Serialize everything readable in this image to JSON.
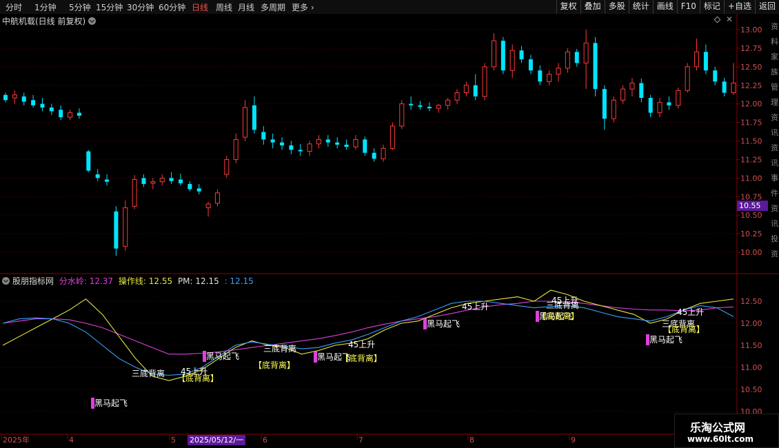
{
  "toolbar": {
    "timeframes": [
      "分时",
      "1分钟",
      "5分钟",
      "15分钟",
      "30分钟",
      "60分钟",
      "日线",
      "周线",
      "月线",
      "多周期",
      "更多"
    ],
    "active": "日线",
    "buttons": [
      "复权",
      "叠加",
      "多股",
      "统计",
      "画线",
      "F10",
      "标记",
      "+自选",
      "返回"
    ]
  },
  "main_chart": {
    "title": "中航机载(日线 前复权)",
    "price_axis_labels": [
      "13.00",
      "12.75",
      "12.50",
      "12.25",
      "12.00",
      "11.75",
      "11.50",
      "11.25",
      "11.00",
      "10.75",
      "10.50",
      "10.25",
      "10.00"
    ],
    "current_price_tag": "10.55"
  },
  "indicator": {
    "name": "股朋指标网",
    "items": [
      {
        "label": "分水岭: 12.37",
        "color": "#e040e0"
      },
      {
        "label": "操作线: 12.55",
        "color": "#e8e840"
      },
      {
        "label": "PM: 12.15",
        "color": "#e0e0e0"
      },
      {
        "label": ": 12.15",
        "color": "#3aa0ff"
      }
    ],
    "axis_labels": [
      "12.50",
      "12.00",
      "11.50",
      "11.00",
      "10.50",
      "10.00"
    ],
    "annotations": [
      "黑马起飞",
      "三底背离",
      "【底背离】",
      "45上升"
    ]
  },
  "date_axis": {
    "labels": [
      "2025年",
      "4",
      "5",
      "6",
      "7",
      "8",
      "9"
    ],
    "highlighted": "2025/05/12/一"
  },
  "side_text": "资料家族管理资讯资讯事件资讯投资",
  "watermark": {
    "line1": "乐淘公式网",
    "line2": "www.60lt.com"
  },
  "colors": {
    "up": "#ff3b3b",
    "down": "#00e5ff",
    "grid": "#5a0000",
    "axis": "#8b0000"
  },
  "chart_data": [
    {
      "type": "candlestick",
      "title": "中航机载(日线 前复权)",
      "ylim": [
        9.9,
        13.1
      ],
      "x": [
        "2025-03",
        "2025-04",
        "2025-05",
        "2025-06",
        "2025-07",
        "2025-08",
        "2025-09"
      ],
      "ohlc": [
        [
          12.12,
          12.15,
          12.02,
          12.05
        ],
        [
          12.08,
          12.18,
          12.0,
          12.12
        ],
        [
          12.1,
          12.15,
          11.98,
          12.03
        ],
        [
          12.05,
          12.12,
          11.95,
          11.98
        ],
        [
          12.0,
          12.08,
          11.9,
          11.95
        ],
        [
          11.95,
          12.0,
          11.85,
          11.9
        ],
        [
          11.92,
          11.98,
          11.78,
          11.82
        ],
        [
          11.82,
          11.92,
          11.78,
          11.88
        ],
        [
          11.88,
          11.94,
          11.8,
          11.84
        ],
        [
          11.36,
          11.38,
          11.08,
          11.1
        ],
        [
          11.05,
          11.12,
          10.96,
          11.0
        ],
        [
          10.98,
          11.05,
          10.9,
          10.95
        ],
        [
          10.55,
          10.62,
          9.95,
          10.05
        ],
        [
          10.08,
          10.7,
          10.02,
          10.6
        ],
        [
          10.62,
          11.04,
          10.58,
          10.98
        ],
        [
          11.0,
          11.05,
          10.88,
          10.92
        ],
        [
          10.93,
          11.0,
          10.85,
          10.95
        ],
        [
          10.95,
          11.05,
          10.9,
          11.0
        ],
        [
          11.0,
          11.08,
          10.92,
          10.96
        ],
        [
          10.98,
          11.06,
          10.9,
          10.93
        ],
        [
          10.92,
          10.96,
          10.82,
          10.85
        ],
        [
          10.86,
          10.92,
          10.78,
          10.82
        ],
        [
          10.6,
          10.68,
          10.48,
          10.65
        ],
        [
          10.66,
          10.85,
          10.62,
          10.8
        ],
        [
          11.05,
          11.3,
          11.0,
          11.25
        ],
        [
          11.25,
          11.6,
          11.2,
          11.52
        ],
        [
          11.55,
          12.05,
          11.5,
          11.95
        ],
        [
          11.98,
          12.1,
          11.6,
          11.65
        ],
        [
          11.62,
          11.7,
          11.45,
          11.52
        ],
        [
          11.52,
          11.6,
          11.4,
          11.48
        ],
        [
          11.48,
          11.55,
          11.38,
          11.44
        ],
        [
          11.44,
          11.5,
          11.32,
          11.38
        ],
        [
          11.38,
          11.46,
          11.3,
          11.36
        ],
        [
          11.36,
          11.5,
          11.3,
          11.46
        ],
        [
          11.46,
          11.58,
          11.4,
          11.52
        ],
        [
          11.52,
          11.58,
          11.42,
          11.48
        ],
        [
          11.48,
          11.55,
          11.4,
          11.45
        ],
        [
          11.45,
          11.52,
          11.38,
          11.42
        ],
        [
          11.42,
          11.58,
          11.38,
          11.52
        ],
        [
          11.52,
          11.56,
          11.3,
          11.34
        ],
        [
          11.34,
          11.4,
          11.22,
          11.26
        ],
        [
          11.26,
          11.45,
          11.22,
          11.4
        ],
        [
          11.4,
          11.75,
          11.38,
          11.7
        ],
        [
          11.7,
          12.05,
          11.66,
          12.0
        ],
        [
          12.0,
          12.1,
          11.92,
          11.98
        ],
        [
          11.98,
          12.04,
          11.92,
          11.96
        ],
        [
          11.96,
          12.02,
          11.9,
          11.94
        ],
        [
          11.94,
          12.0,
          11.88,
          11.98
        ],
        [
          11.98,
          12.08,
          11.92,
          12.05
        ],
        [
          12.05,
          12.2,
          12.0,
          12.15
        ],
        [
          12.15,
          12.3,
          12.1,
          12.25
        ],
        [
          12.25,
          12.4,
          12.05,
          12.1
        ],
        [
          12.1,
          12.55,
          12.05,
          12.5
        ],
        [
          12.5,
          12.95,
          12.45,
          12.85
        ],
        [
          12.85,
          12.9,
          12.4,
          12.45
        ],
        [
          12.45,
          12.8,
          12.35,
          12.72
        ],
        [
          12.72,
          12.78,
          12.55,
          12.6
        ],
        [
          12.6,
          12.66,
          12.4,
          12.45
        ],
        [
          12.45,
          12.52,
          12.25,
          12.3
        ],
        [
          12.3,
          12.45,
          12.25,
          12.4
        ],
        [
          12.4,
          12.55,
          12.3,
          12.48
        ],
        [
          12.48,
          12.75,
          12.42,
          12.7
        ],
        [
          12.7,
          12.74,
          12.5,
          12.55
        ],
        [
          12.55,
          13.0,
          12.2,
          12.82
        ],
        [
          12.82,
          12.9,
          12.1,
          12.2
        ],
        [
          12.2,
          12.25,
          11.65,
          11.8
        ],
        [
          11.8,
          12.1,
          11.75,
          12.05
        ],
        [
          12.05,
          12.25,
          12.0,
          12.2
        ],
        [
          12.2,
          12.35,
          12.1,
          12.28
        ],
        [
          12.28,
          12.34,
          12.02,
          12.08
        ],
        [
          12.08,
          12.12,
          11.82,
          11.88
        ],
        [
          11.88,
          12.08,
          11.82,
          12.02
        ],
        [
          12.02,
          12.1,
          11.92,
          11.98
        ],
        [
          11.98,
          12.22,
          11.94,
          12.18
        ],
        [
          12.18,
          12.55,
          12.15,
          12.5
        ],
        [
          12.5,
          12.88,
          12.45,
          12.7
        ],
        [
          12.7,
          12.8,
          12.4,
          12.45
        ],
        [
          12.45,
          12.5,
          12.25,
          12.3
        ],
        [
          12.3,
          12.35,
          12.1,
          12.15
        ],
        [
          12.15,
          12.55,
          12.12,
          12.28
        ]
      ]
    },
    {
      "type": "line",
      "title": "股朋指标网",
      "ylim": [
        9.95,
        12.75
      ],
      "x": [
        "2025-03",
        "2025-04",
        "2025-05",
        "2025-06",
        "2025-07",
        "2025-08",
        "2025-09"
      ],
      "series": [
        {
          "name": "分水岭",
          "values": [
            12.0,
            12.05,
            12.1,
            12.1,
            12.08,
            12.0,
            11.9,
            11.75,
            11.6,
            11.45,
            11.3,
            11.3,
            11.32,
            11.35,
            11.4,
            11.45,
            11.5,
            11.55,
            11.6,
            11.65,
            11.72,
            11.8,
            11.9,
            11.98,
            12.05,
            12.1,
            12.15,
            12.22,
            12.3,
            12.37,
            12.42,
            12.45,
            12.5,
            12.5,
            12.48,
            12.45,
            12.4,
            12.35,
            12.32,
            12.3,
            12.3,
            12.28,
            12.3,
            12.35,
            12.37
          ]
        },
        {
          "name": "操作线",
          "values": [
            11.5,
            11.7,
            11.9,
            12.1,
            12.3,
            12.55,
            12.2,
            11.7,
            11.2,
            10.8,
            10.7,
            10.8,
            10.95,
            11.2,
            11.45,
            11.6,
            11.5,
            11.45,
            11.3,
            11.38,
            11.5,
            11.55,
            11.65,
            11.85,
            12.0,
            12.05,
            12.2,
            12.35,
            12.45,
            12.5,
            12.55,
            12.6,
            12.5,
            12.75,
            12.65,
            12.5,
            12.4,
            12.3,
            12.2,
            12.0,
            12.1,
            12.3,
            12.45,
            12.5,
            12.55
          ]
        },
        {
          "name": "PM",
          "values": [
            12.0,
            12.1,
            12.12,
            12.1,
            12.0,
            11.8,
            11.5,
            11.2,
            11.0,
            10.85,
            10.82,
            10.85,
            11.0,
            11.25,
            11.5,
            11.58,
            11.52,
            11.48,
            11.42,
            11.45,
            11.55,
            11.62,
            11.75,
            11.9,
            12.05,
            12.15,
            12.3,
            12.45,
            12.5,
            12.5,
            12.45,
            12.4,
            12.35,
            12.38,
            12.4,
            12.35,
            12.25,
            12.15,
            12.1,
            12.05,
            12.15,
            12.3,
            12.4,
            12.35,
            12.15
          ]
        }
      ]
    }
  ]
}
